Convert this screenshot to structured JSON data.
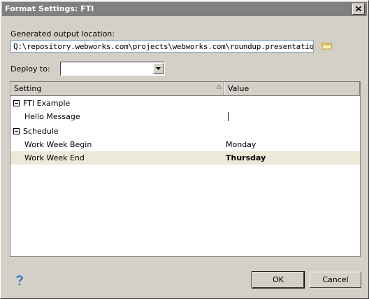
{
  "window": {
    "title": "Format Settings: FTI"
  },
  "output": {
    "label": "Generated output location:",
    "value": "Q:\\repository.webworks.com\\projects\\webworks.com\\roundup.presentation.jwil...\\FTI"
  },
  "deploy": {
    "label": "Deploy to:",
    "value": ""
  },
  "grid": {
    "columns": [
      "Setting",
      "Value"
    ],
    "groups": [
      {
        "name": "FTI Example",
        "rows": [
          {
            "setting": "Hello Message",
            "value": ""
          }
        ]
      },
      {
        "name": "Schedule",
        "rows": [
          {
            "setting": "Work Week Begin",
            "value": "Monday"
          },
          {
            "setting": "Work Week End",
            "value": "Thursday"
          }
        ]
      }
    ]
  },
  "buttons": {
    "ok": "OK",
    "cancel": "Cancel"
  },
  "icons": {
    "help": "help-icon",
    "folder": "folder-icon",
    "close": "close-icon"
  }
}
